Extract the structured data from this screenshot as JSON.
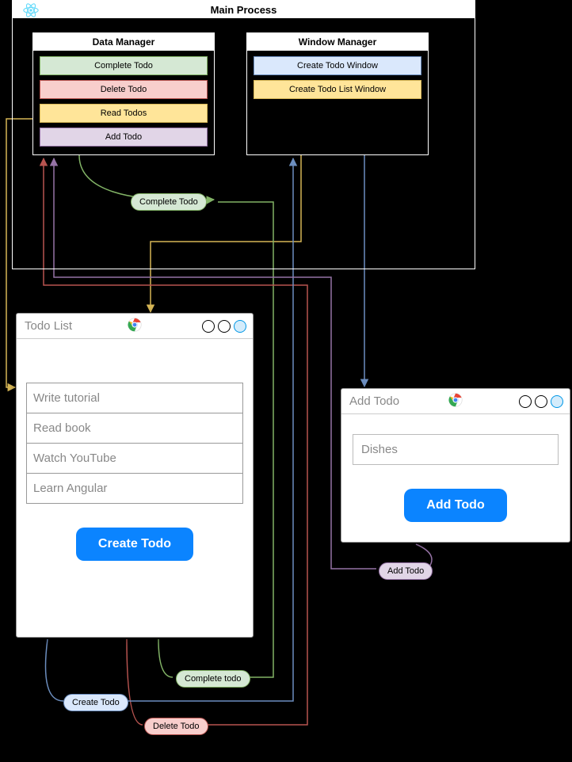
{
  "main_process": {
    "title": "Main Process",
    "data_manager": {
      "title": "Data Manager",
      "items": [
        {
          "label": "Complete Todo",
          "style": "green"
        },
        {
          "label": "Delete Todo",
          "style": "red"
        },
        {
          "label": "Read Todos",
          "style": "yellow"
        },
        {
          "label": "Add Todo",
          "style": "purple"
        }
      ]
    },
    "window_manager": {
      "title": "Window Manager",
      "items": [
        {
          "label": "Create Todo Window",
          "style": "blue"
        },
        {
          "label": "Create Todo List Window",
          "style": "yellow"
        }
      ]
    }
  },
  "todo_list_window": {
    "title": "Todo List",
    "items": [
      "Write tutorial",
      "Read book",
      "Watch YouTube",
      "Learn Angular"
    ],
    "button": "Create Todo"
  },
  "add_todo_window": {
    "title": "Add Todo",
    "input_value": "Dishes",
    "button": "Add Todo"
  },
  "edge_labels": {
    "complete_todo_top": "Complete Todo",
    "complete_todo_bottom": "Complete todo",
    "delete_todo": "Delete Todo",
    "create_todo": "Create Todo",
    "add_todo": "Add Todo"
  }
}
